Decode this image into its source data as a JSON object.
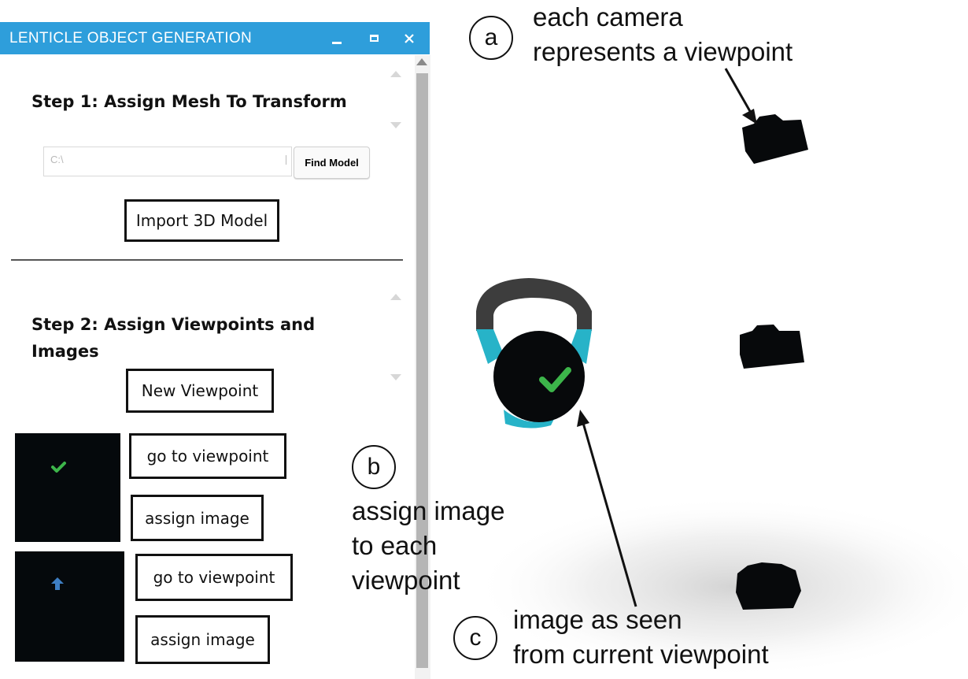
{
  "window": {
    "title": "LENTICLE OBJECT GENERATION",
    "controls": [
      "minimize-icon",
      "maximize-icon",
      "close-icon"
    ],
    "accent_color": "#2e9edb"
  },
  "step1": {
    "title": "Step 1: Assign Mesh To Transform",
    "path_value": "C:\\",
    "find_button": "Find Model",
    "import_button": "Import 3D Model"
  },
  "step2": {
    "title_line1": "Step 2: Assign Viewpoints and",
    "title_line2": "Images",
    "new_viewpoint_button": "New Viewpoint",
    "viewpoints": [
      {
        "thumbnail_icon": "check-icon",
        "go_label": "go to viewpoint",
        "assign_label": "assign image"
      },
      {
        "thumbnail_icon": "arrow-up-icon",
        "go_label": "go to viewpoint",
        "assign_label": "assign image"
      }
    ]
  },
  "annotations": {
    "a": {
      "marker": "a",
      "line1": "each camera",
      "line2": "represents a viewpoint"
    },
    "b": {
      "marker": "b",
      "line1": "assign image",
      "line2": "to each",
      "line3": "viewpoint"
    },
    "c": {
      "marker": "c",
      "line1": "image as seen",
      "line2": "from current viewpoint"
    }
  },
  "scene": {
    "object": "kettlebell",
    "object_icon": "check-icon",
    "cameras": [
      "camera-icon",
      "camera-icon",
      "camera-icon"
    ],
    "colors": {
      "handle": "#3d3d3d",
      "band": "#27b3c8",
      "body": "#07090b",
      "check": "#3cb54a",
      "arrow": "#3e7fc4"
    }
  }
}
